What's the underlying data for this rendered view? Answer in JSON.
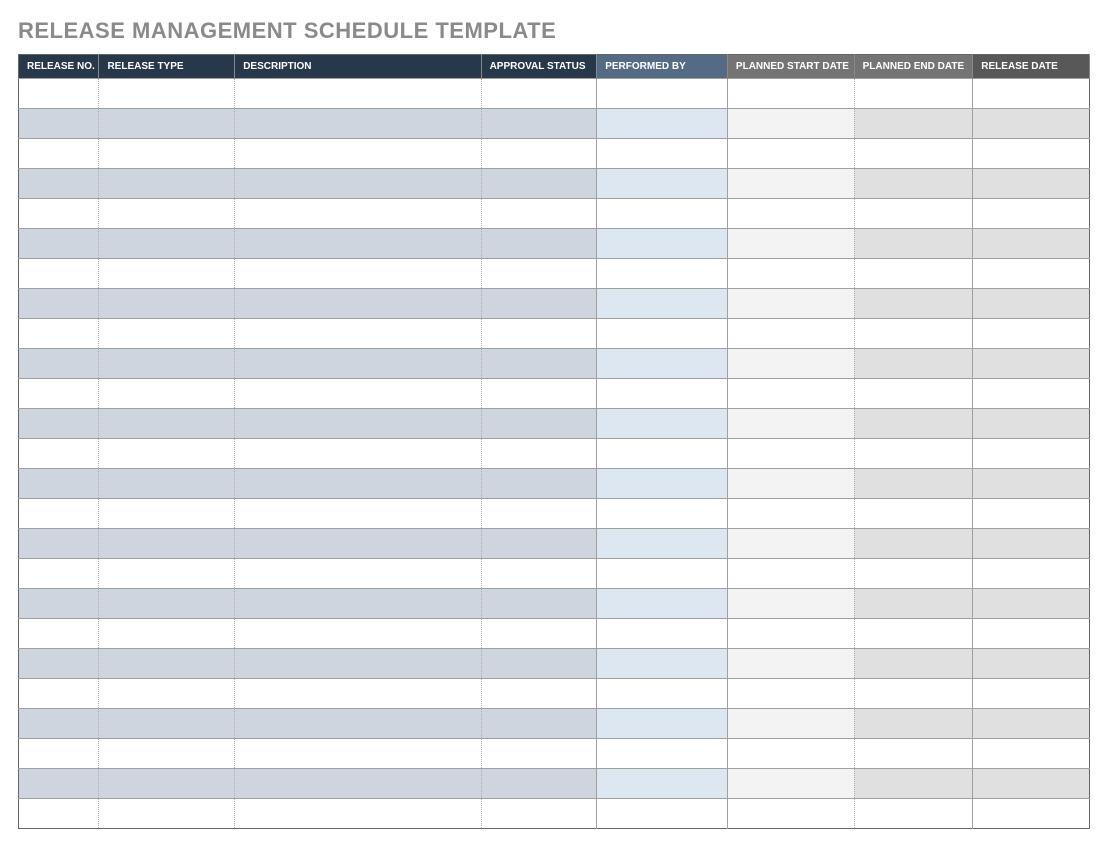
{
  "title": "RELEASE MANAGEMENT SCHEDULE TEMPLATE",
  "columns": [
    "RELEASE NO.",
    "RELEASE TYPE",
    "DESCRIPTION",
    "APPROVAL STATUS",
    "PERFORMED BY",
    "PLANNED START DATE",
    "PLANNED END DATE",
    "RELEASE DATE"
  ],
  "row_count": 25,
  "rows": [
    [
      "",
      "",
      "",
      "",
      "",
      "",
      "",
      ""
    ],
    [
      "",
      "",
      "",
      "",
      "",
      "",
      "",
      ""
    ],
    [
      "",
      "",
      "",
      "",
      "",
      "",
      "",
      ""
    ],
    [
      "",
      "",
      "",
      "",
      "",
      "",
      "",
      ""
    ],
    [
      "",
      "",
      "",
      "",
      "",
      "",
      "",
      ""
    ],
    [
      "",
      "",
      "",
      "",
      "",
      "",
      "",
      ""
    ],
    [
      "",
      "",
      "",
      "",
      "",
      "",
      "",
      ""
    ],
    [
      "",
      "",
      "",
      "",
      "",
      "",
      "",
      ""
    ],
    [
      "",
      "",
      "",
      "",
      "",
      "",
      "",
      ""
    ],
    [
      "",
      "",
      "",
      "",
      "",
      "",
      "",
      ""
    ],
    [
      "",
      "",
      "",
      "",
      "",
      "",
      "",
      ""
    ],
    [
      "",
      "",
      "",
      "",
      "",
      "",
      "",
      ""
    ],
    [
      "",
      "",
      "",
      "",
      "",
      "",
      "",
      ""
    ],
    [
      "",
      "",
      "",
      "",
      "",
      "",
      "",
      ""
    ],
    [
      "",
      "",
      "",
      "",
      "",
      "",
      "",
      ""
    ],
    [
      "",
      "",
      "",
      "",
      "",
      "",
      "",
      ""
    ],
    [
      "",
      "",
      "",
      "",
      "",
      "",
      "",
      ""
    ],
    [
      "",
      "",
      "",
      "",
      "",
      "",
      "",
      ""
    ],
    [
      "",
      "",
      "",
      "",
      "",
      "",
      "",
      ""
    ],
    [
      "",
      "",
      "",
      "",
      "",
      "",
      "",
      ""
    ],
    [
      "",
      "",
      "",
      "",
      "",
      "",
      "",
      ""
    ],
    [
      "",
      "",
      "",
      "",
      "",
      "",
      "",
      ""
    ],
    [
      "",
      "",
      "",
      "",
      "",
      "",
      "",
      ""
    ],
    [
      "",
      "",
      "",
      "",
      "",
      "",
      "",
      ""
    ],
    [
      "",
      "",
      "",
      "",
      "",
      "",
      "",
      ""
    ]
  ]
}
